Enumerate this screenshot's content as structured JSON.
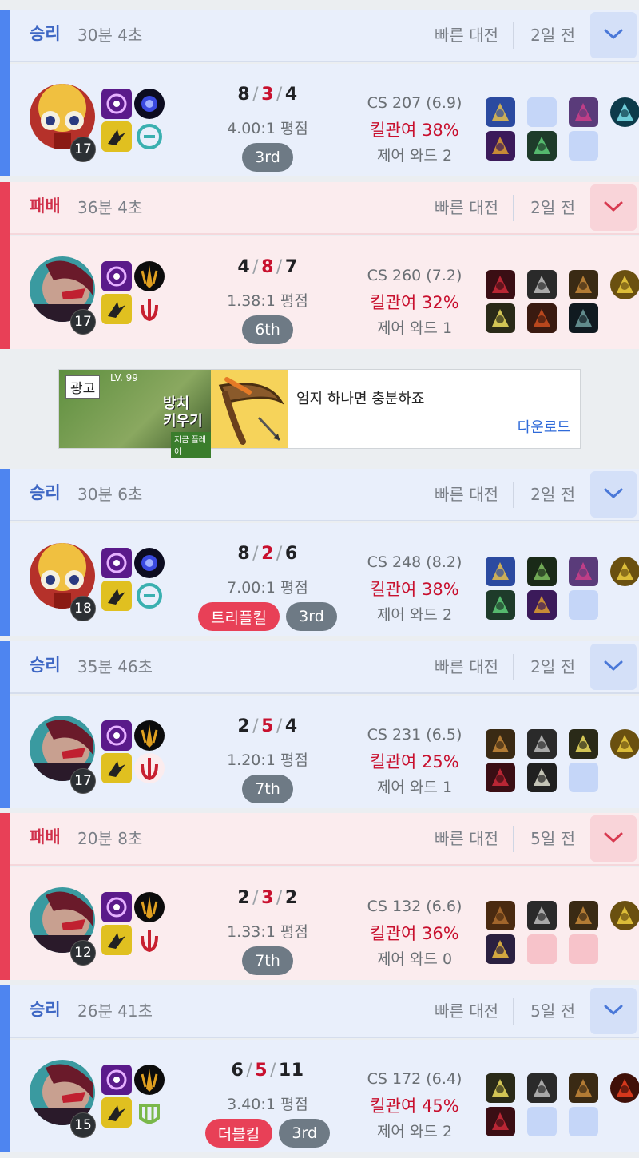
{
  "matches": [
    {
      "result": "승리",
      "outcome": "win",
      "duration": "30분 4초",
      "queue": "빠른 대전",
      "ago": "2일 전",
      "champion_icon": "champion-yellow-feral-icon",
      "level": "17",
      "kda": {
        "kills": "8",
        "deaths": "3",
        "assists": "4"
      },
      "ratio": "4.00:1 평점",
      "badges": [],
      "placement": "3rd",
      "cs": "CS 207 (6.9)",
      "kill_participation": "킬관여 38%",
      "control_wards": "제어 와드 2",
      "items": [
        "item-gold-amulet",
        "empty",
        "item-purple-spider",
        "item-blue-orb-trinket",
        "item-purple-crown",
        "item-green-boots",
        "empty"
      ]
    },
    {
      "result": "패배",
      "outcome": "loss",
      "duration": "36분 4초",
      "queue": "빠른 대전",
      "ago": "2일 전",
      "champion_icon": "champion-cyborg-red-icon",
      "level": "17",
      "kda": {
        "kills": "4",
        "deaths": "8",
        "assists": "7"
      },
      "ratio": "1.38:1 평점",
      "badges": [],
      "placement": "6th",
      "cs": "CS 260 (7.2)",
      "kill_participation": "킬관여 32%",
      "control_wards": "제어 와드 1",
      "items": [
        "item-red-armor",
        "item-grey-boots",
        "item-bronze-hammer",
        "item-gold-lantern-trinket",
        "item-lightning-blade",
        "item-red-bow",
        "item-dark-sword"
      ]
    },
    {
      "result": "승리",
      "outcome": "win",
      "duration": "30분 6초",
      "queue": "빠른 대전",
      "ago": "2일 전",
      "champion_icon": "champion-yellow-feral-icon",
      "level": "18",
      "kda": {
        "kills": "8",
        "deaths": "2",
        "assists": "6"
      },
      "ratio": "7.00:1 평점",
      "badges": [
        "트리플킬"
      ],
      "placement": "3rd",
      "cs": "CS 248 (8.2)",
      "kill_participation": "킬관여 38%",
      "control_wards": "제어 와드 2",
      "items": [
        "item-gold-amulet",
        "item-green-claws",
        "item-purple-spider",
        "item-gold-lantern-trinket",
        "item-green-boots",
        "item-purple-crown",
        "empty"
      ]
    },
    {
      "result": "승리",
      "outcome": "win",
      "duration": "35분 46초",
      "queue": "빠른 대전",
      "ago": "2일 전",
      "champion_icon": "champion-cyborg-red-icon",
      "level": "17",
      "kda": {
        "kills": "2",
        "deaths": "5",
        "assists": "4"
      },
      "ratio": "1.20:1 평점",
      "badges": [],
      "placement": "7th",
      "cs": "CS 231 (6.5)",
      "kill_participation": "킬관여 25%",
      "control_wards": "제어 와드 1",
      "items": [
        "item-bronze-hammer",
        "item-grey-boots",
        "item-lightning-blade",
        "item-gold-lantern-trinket",
        "item-red-armor",
        "item-silver-sword",
        "empty"
      ]
    },
    {
      "result": "패배",
      "outcome": "loss",
      "duration": "20분 8초",
      "queue": "빠른 대전",
      "ago": "5일 전",
      "champion_icon": "champion-cyborg-red-icon",
      "level": "12",
      "kda": {
        "kills": "2",
        "deaths": "3",
        "assists": "2"
      },
      "ratio": "1.33:1 평점",
      "badges": [],
      "placement": "7th",
      "cs": "CS 132 (6.6)",
      "kill_participation": "킬관여 36%",
      "control_wards": "제어 와드 0",
      "items": [
        "item-brown-shield",
        "item-grey-boots",
        "item-bronze-hammer",
        "item-gold-lantern-trinket",
        "item-gold-staff",
        "empty",
        "empty"
      ]
    },
    {
      "result": "승리",
      "outcome": "win",
      "duration": "26분 41초",
      "queue": "빠른 대전",
      "ago": "5일 전",
      "champion_icon": "champion-cyborg-red-icon",
      "level": "15",
      "kda": {
        "kills": "6",
        "deaths": "5",
        "assists": "11"
      },
      "ratio": "3.40:1 평점",
      "badges": [
        "더블킬"
      ],
      "placement": "3rd",
      "cs": "CS 172 (6.4)",
      "kill_participation": "킬관여 45%",
      "control_wards": "제어 와드 2",
      "items": [
        "item-lightning-blade",
        "item-grey-boots",
        "item-bronze-hammer",
        "item-red-lens-trinket",
        "item-red-armor",
        "empty",
        "empty"
      ]
    }
  ],
  "ad": {
    "tag": "광고",
    "headline": "엄지 하나면 충분하죠",
    "cta": "다운로드",
    "image_level": "LV. 99",
    "image_title_line1": "방치",
    "image_title_line2": "키우기",
    "image_button": "지금 플레이"
  }
}
